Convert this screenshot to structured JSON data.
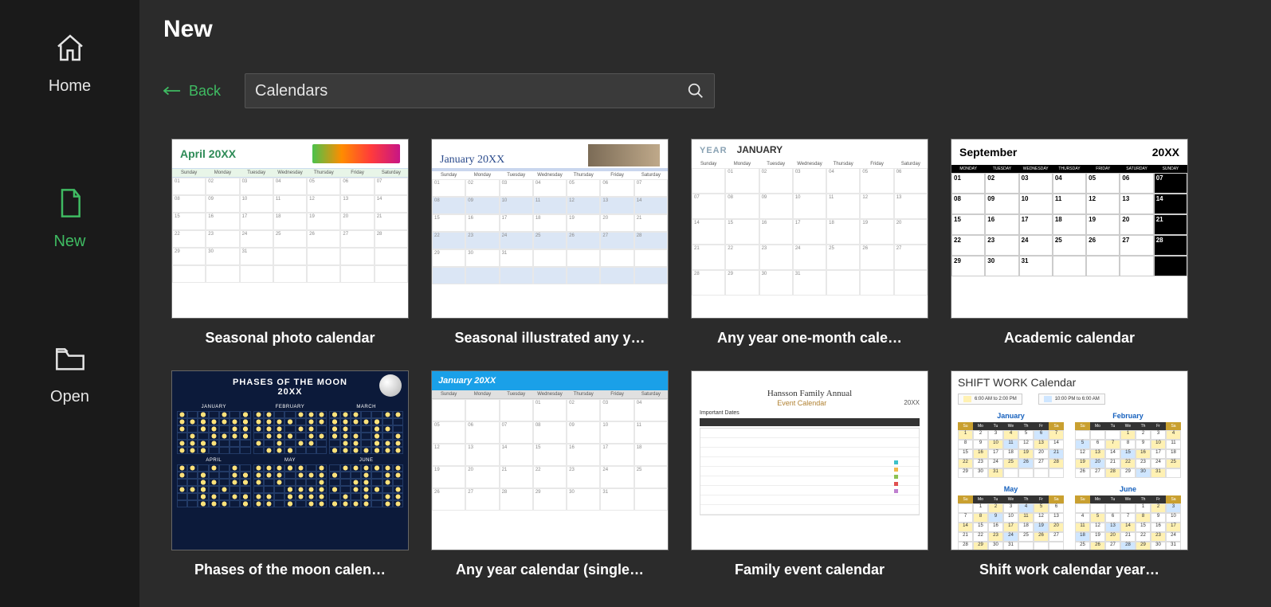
{
  "page": {
    "title": "New"
  },
  "sidebar": {
    "home": "Home",
    "new": "New",
    "open": "Open"
  },
  "back": {
    "label": "Back"
  },
  "search": {
    "value": "Calendars"
  },
  "templates": [
    {
      "label": "Seasonal photo calendar",
      "thumb_title": "April 20XX"
    },
    {
      "label": "Seasonal illustrated any y…",
      "thumb_title": "January 20XX"
    },
    {
      "label": "Any year one-month cale…",
      "thumb_year": "YEAR",
      "thumb_month": "JANUARY"
    },
    {
      "label": "Academic calendar",
      "thumb_title": "September",
      "thumb_year": "20XX"
    },
    {
      "label": "Phases of the moon calen…",
      "thumb_title": "PHASES OF THE MOON",
      "thumb_year": "20XX",
      "months": [
        "JANUARY",
        "FEBRUARY",
        "MARCH",
        "APRIL",
        "MAY",
        "JUNE"
      ]
    },
    {
      "label": "Any year calendar (single…",
      "thumb_title": "January 20XX"
    },
    {
      "label": "Family event calendar",
      "thumb_title": "Hansson Family Annual",
      "thumb_sub": "Event Calendar",
      "thumb_line": "Important Dates",
      "thumb_year": "20XX"
    },
    {
      "label": "Shift work calendar year…",
      "thumb_title_a": "SHIFT WORK",
      "thumb_title_b": "Calendar",
      "legend": [
        "6:00 AM to 2:00 PM",
        "10:00 PM to 6:00 AM"
      ],
      "months": [
        "January",
        "February",
        "May",
        "June"
      ]
    }
  ],
  "day_abbrev": [
    "Su",
    "Mo",
    "Tu",
    "We",
    "Th",
    "Fr",
    "Sa"
  ],
  "day_full": [
    "Sunday",
    "Monday",
    "Tuesday",
    "Wednesday",
    "Thursday",
    "Friday",
    "Saturday"
  ]
}
